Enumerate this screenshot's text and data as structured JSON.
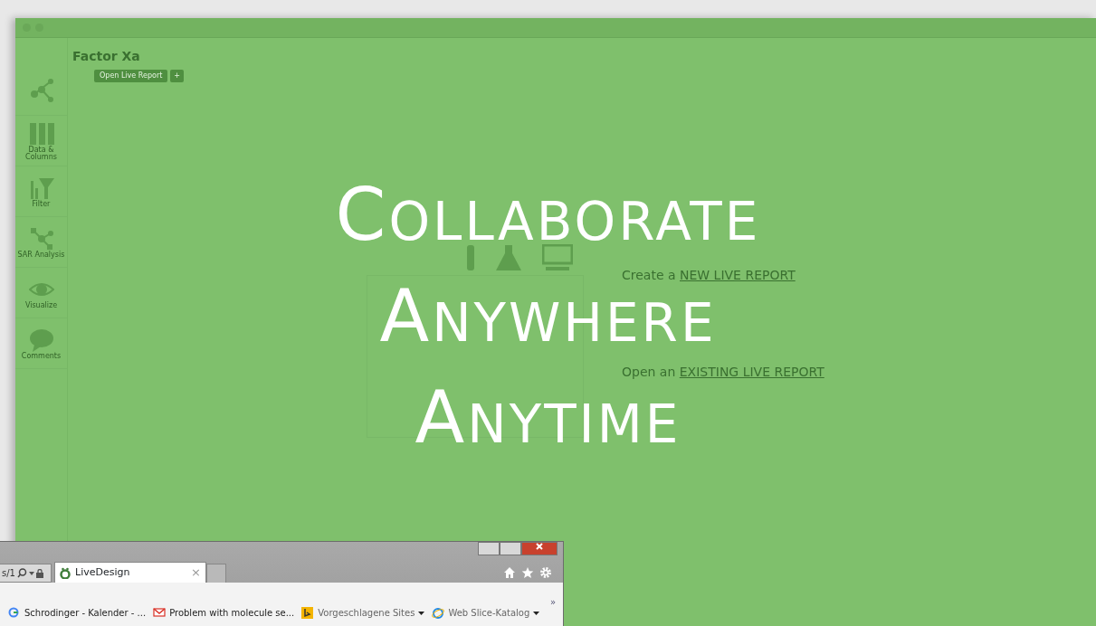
{
  "app": {
    "project_title": "Factor Xa",
    "open_button": "Open Live Report",
    "add_button": "+",
    "sidebar": [
      {
        "kind": "network"
      },
      {
        "kind": "columns",
        "label": "Data & Columns"
      },
      {
        "kind": "filter",
        "label": "Filter"
      },
      {
        "kind": "sar",
        "label": "SAR Analysis"
      },
      {
        "kind": "eye",
        "label": "Visualize"
      },
      {
        "kind": "comment",
        "label": "Comments"
      }
    ],
    "welcome": [
      {
        "prefix": "Create a",
        "link": "NEW LIVE REPORT"
      },
      {
        "prefix": "Open an",
        "link": "EXISTING LIVE REPORT"
      }
    ]
  },
  "headline": [
    "COLLABORATE",
    "ANYWHERE",
    "ANYTIME"
  ],
  "browser": {
    "address_fragment": "s/1",
    "tab": {
      "title": "LiveDesign",
      "close": "×"
    },
    "favorites": [
      {
        "kind": "google",
        "label": "Schrodinger - Kalender - ...",
        "dropdown": false
      },
      {
        "kind": "gmail",
        "label": "Problem with molecule se...",
        "dropdown": false
      },
      {
        "kind": "bing",
        "label": "Vorgeschlagene Sites",
        "dropdown": true
      },
      {
        "kind": "ie",
        "label": "Web Slice-Katalog",
        "dropdown": true
      }
    ],
    "overflow": "»"
  }
}
